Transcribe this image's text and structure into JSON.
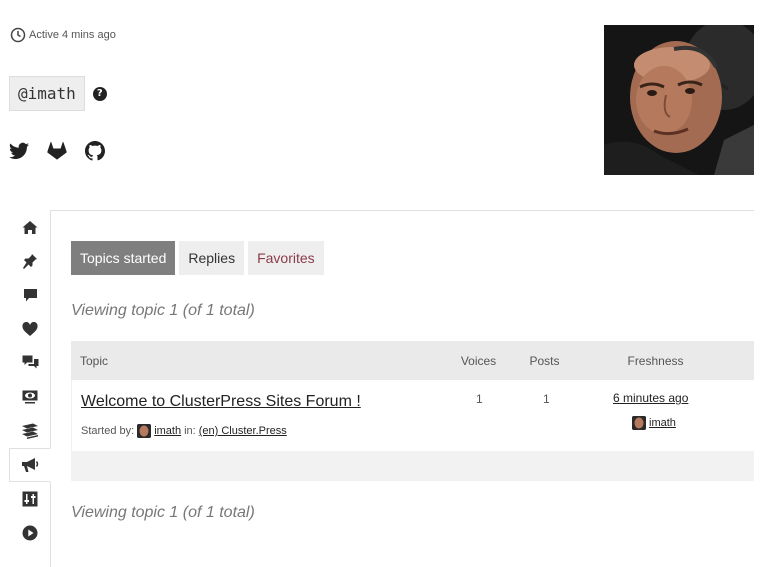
{
  "profile": {
    "active_text": "Active 4 mins ago",
    "handle": "@imath",
    "help_glyph": "?",
    "social": [
      {
        "icon": "twitter-icon"
      },
      {
        "icon": "gitlab-icon"
      },
      {
        "icon": "github-icon"
      }
    ]
  },
  "sidenav": {
    "items": [
      {
        "icon": "home-icon"
      },
      {
        "icon": "pin-icon"
      },
      {
        "icon": "comment-icon"
      },
      {
        "icon": "heart-icon"
      },
      {
        "icon": "comments-icon"
      },
      {
        "icon": "eye-icon"
      },
      {
        "icon": "layers-icon"
      },
      {
        "icon": "megaphone-icon",
        "current": true
      },
      {
        "icon": "settings-icon"
      },
      {
        "icon": "play-icon"
      }
    ]
  },
  "tabs": [
    {
      "label": "Topics started",
      "selected": true
    },
    {
      "label": "Replies"
    },
    {
      "label": "Favorites"
    }
  ],
  "viewing_top": "Viewing topic 1 (of 1 total)",
  "viewing_bottom": "Viewing topic 1 (of 1 total)",
  "table": {
    "headers": {
      "topic": "Topic",
      "voices": "Voices",
      "posts": "Posts",
      "freshness": "Freshness"
    },
    "rows": [
      {
        "title": "Welcome to ClusterPress Sites Forum !",
        "started_by_label": "Started by:",
        "author": "imath",
        "in_label": "in:",
        "forum": "(en) Cluster.Press",
        "voices": "1",
        "posts": "1",
        "freshness": "6 minutes ago",
        "last_user": "imath"
      }
    ]
  },
  "colors": {
    "selected_tab_bg": "#7f7f7f",
    "favorites_text": "#8a3b4b"
  }
}
